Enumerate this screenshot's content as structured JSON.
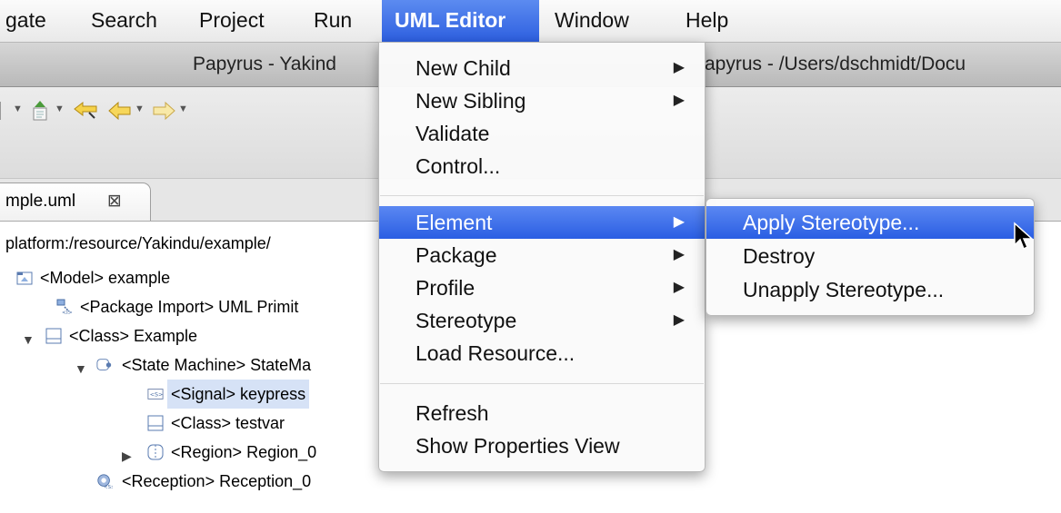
{
  "menubar": {
    "items": [
      {
        "label": "gate"
      },
      {
        "label": "Search"
      },
      {
        "label": "Project"
      },
      {
        "label": "Run"
      },
      {
        "label": "UML Editor"
      },
      {
        "label": "Window"
      },
      {
        "label": "Help"
      }
    ]
  },
  "window": {
    "title_left": "Papyrus - Yakind",
    "title_right": "apyrus - /Users/dschmidt/Docu"
  },
  "editor_tab": {
    "label": "mple.uml",
    "close_glyph": "⊠"
  },
  "tree": {
    "root_path": "platform:/resource/Yakindu/example/",
    "nodes": [
      {
        "label": "<Model> example"
      },
      {
        "label": "<Package Import> UML Primit"
      },
      {
        "label": "<Class> Example"
      },
      {
        "label": "<State Machine> StateMa"
      },
      {
        "label": "<Signal> keypress"
      },
      {
        "label": "<Class> testvar"
      },
      {
        "label": "<Region> Region_0"
      },
      {
        "label": "<Reception> Reception_0"
      }
    ]
  },
  "uml_menu": {
    "items": [
      {
        "label": "New Child"
      },
      {
        "label": "New Sibling"
      },
      {
        "label": "Validate"
      },
      {
        "label": "Control..."
      },
      {
        "label": "Element"
      },
      {
        "label": "Package"
      },
      {
        "label": "Profile"
      },
      {
        "label": "Stereotype"
      },
      {
        "label": "Load Resource..."
      },
      {
        "label": "Refresh"
      },
      {
        "label": "Show Properties View"
      }
    ],
    "submenu_arrow": "▶"
  },
  "element_submenu": {
    "items": [
      {
        "label": "Apply Stereotype..."
      },
      {
        "label": "Destroy"
      },
      {
        "label": "Unapply Stereotype..."
      }
    ]
  },
  "colors": {
    "menu_highlight": "#2d5fe0",
    "selection": "#d6e2f6"
  }
}
